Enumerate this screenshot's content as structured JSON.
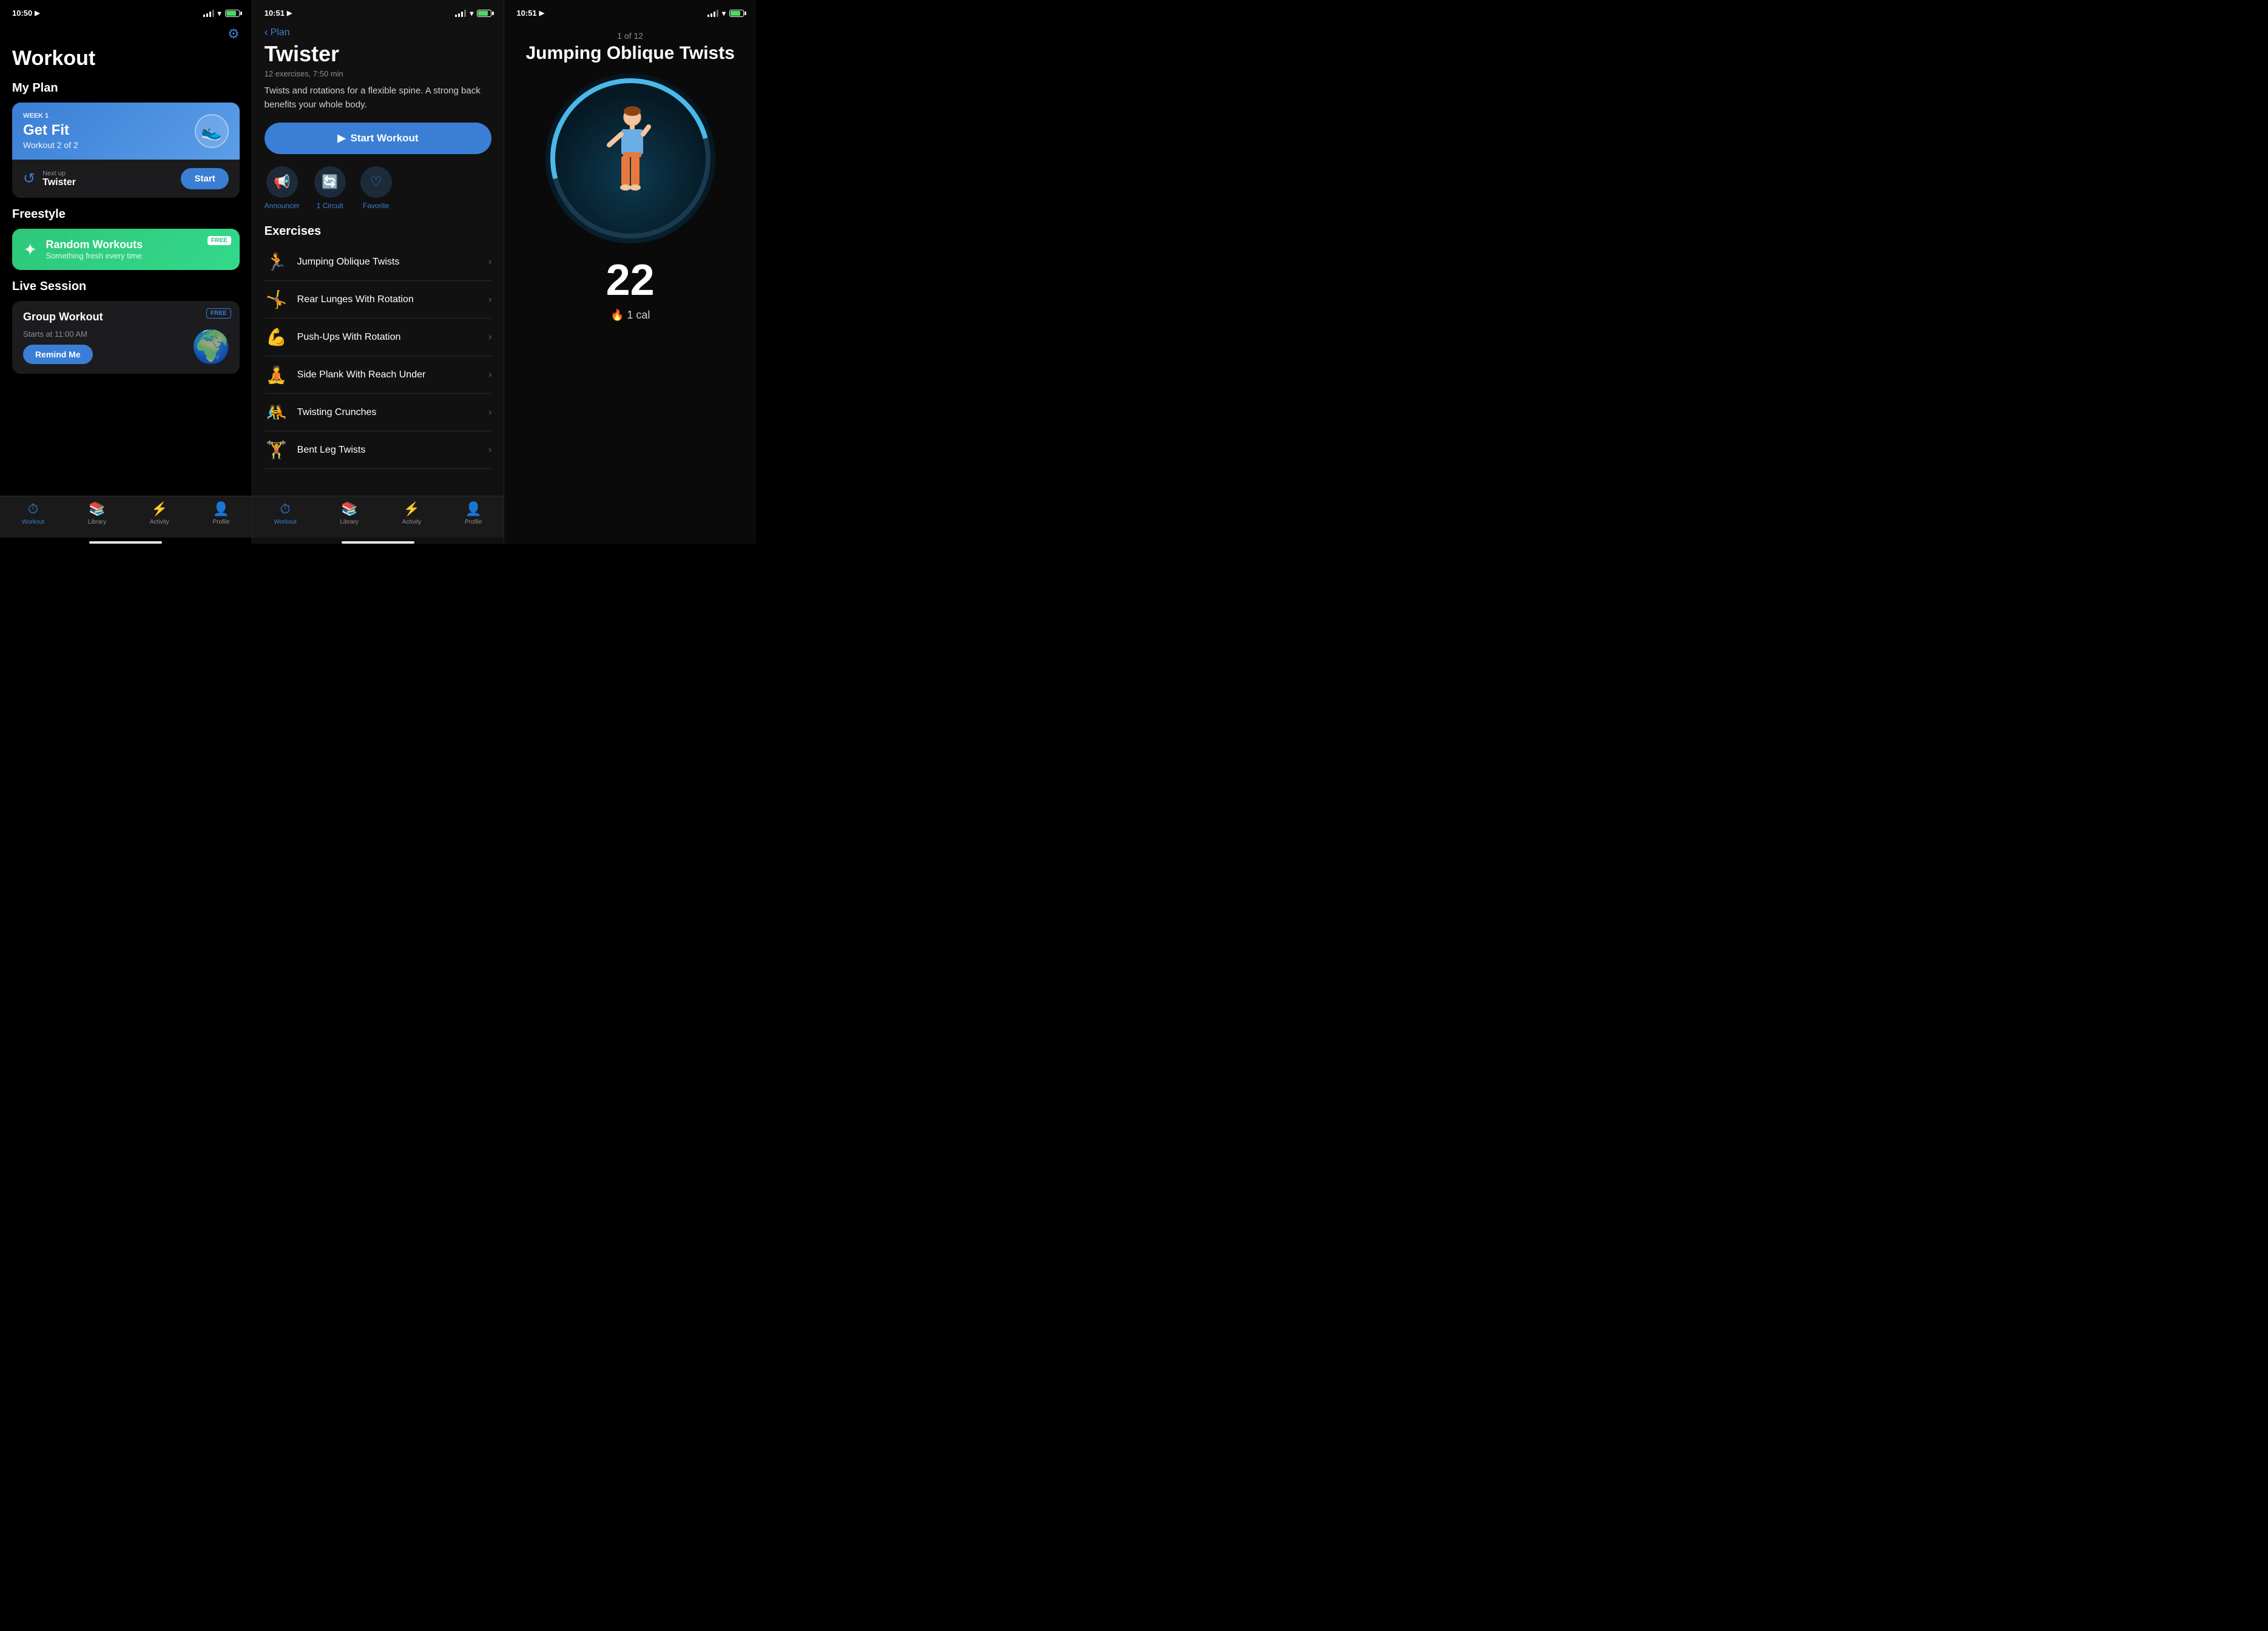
{
  "panel1": {
    "statusBar": {
      "time": "10:50",
      "hasLocation": true
    },
    "gearIcon": "⚙",
    "title": "Workout",
    "myPlan": {
      "label": "My Plan",
      "week": "WEEK 1",
      "name": "Get Fit",
      "sub": "Workout 2 of 2",
      "shoeEmoji": "👟",
      "nextUpLabel": "Next up",
      "nextUpName": "Twister",
      "startBtn": "Start"
    },
    "freestyle": {
      "label": "Freestyle",
      "badge": "FREE",
      "title": "Random Workouts",
      "sub": "Something fresh every time"
    },
    "liveSession": {
      "label": "Live Session",
      "badge": "FREE",
      "title": "Group Workout",
      "time": "Starts at 11:00 AM",
      "btn": "Remind Me"
    },
    "tabBar": {
      "items": [
        {
          "icon": "⏱",
          "label": "Workout",
          "active": true
        },
        {
          "icon": "📚",
          "label": "Library",
          "active": false
        },
        {
          "icon": "⚡",
          "label": "Activity",
          "active": false
        },
        {
          "icon": "👤",
          "label": "Profile",
          "active": false
        }
      ]
    }
  },
  "panel2": {
    "statusBar": {
      "time": "10:51",
      "hasLocation": true
    },
    "backLabel": "Plan",
    "title": "Twister",
    "meta": "12 exercises, 7:50 min",
    "desc": "Twists and rotations for a flexible spine. A strong back benefits your whole body.",
    "startBtn": "Start Workout",
    "options": [
      {
        "icon": "📢",
        "label": "Announcer"
      },
      {
        "icon": "🔄",
        "label": "1 Circuit"
      },
      {
        "icon": "♡",
        "label": "Favorite"
      }
    ],
    "exercisesLabel": "Exercises",
    "exercises": [
      {
        "name": "Jumping Oblique Twists"
      },
      {
        "name": "Rear Lunges With Rotation"
      },
      {
        "name": "Push-Ups With Rotation"
      },
      {
        "name": "Side Plank With Reach Under"
      },
      {
        "name": "Twisting Crunches"
      },
      {
        "name": "Bent Leg Twists"
      }
    ],
    "tabBar": {
      "items": [
        {
          "icon": "⏱",
          "label": "Workout",
          "active": true
        },
        {
          "icon": "📚",
          "label": "Library",
          "active": false
        },
        {
          "icon": "⚡",
          "label": "Activity",
          "active": false
        },
        {
          "icon": "👤",
          "label": "Profile",
          "active": false
        }
      ]
    }
  },
  "panel3": {
    "statusBar": {
      "time": "10:51",
      "hasLocation": true
    },
    "counter": "1 of 12",
    "exerciseName": "Jumping Oblique Twists",
    "repCount": "22",
    "calInfo": "🔥 1 cal"
  }
}
